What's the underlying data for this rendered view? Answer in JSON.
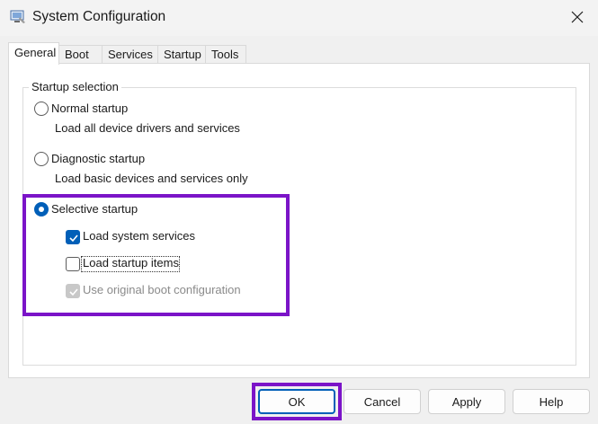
{
  "window": {
    "title": "System Configuration",
    "icon": "msconfig-icon",
    "close_icon": "close-icon"
  },
  "tabs": [
    {
      "label": "General",
      "active": true
    },
    {
      "label": "Boot",
      "active": false
    },
    {
      "label": "Services",
      "active": false
    },
    {
      "label": "Startup",
      "active": false
    },
    {
      "label": "Tools",
      "active": false
    }
  ],
  "startup_selection": {
    "legend": "Startup selection",
    "normal": {
      "label": "Normal startup",
      "description": "Load all device drivers and services",
      "selected": false
    },
    "diagnostic": {
      "label": "Diagnostic startup",
      "description": "Load basic devices and services only",
      "selected": false
    },
    "selective": {
      "label": "Selective startup",
      "selected": true,
      "options": [
        {
          "label": "Load system services",
          "checked": true,
          "enabled": true
        },
        {
          "label": "Load startup items",
          "checked": false,
          "enabled": true
        },
        {
          "label": "Use original boot configuration",
          "checked": true,
          "enabled": false
        }
      ]
    }
  },
  "buttons": {
    "ok": "OK",
    "cancel": "Cancel",
    "apply": "Apply",
    "help": "Help"
  },
  "colors": {
    "accent": "#005fb8",
    "highlight": "#7b14c8"
  }
}
